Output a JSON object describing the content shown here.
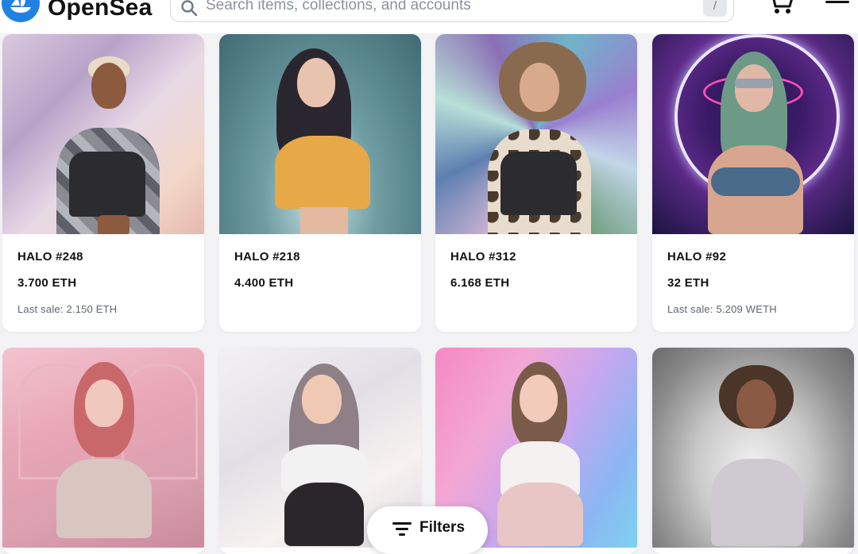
{
  "header": {
    "logo_text": "OpenSea",
    "search_placeholder": "Search items, collections, and accounts",
    "search_shortcut": "/"
  },
  "cards": [
    {
      "name": "HALO #248",
      "price": "3.700 ETH",
      "last_sale": "Last sale: 2.150 ETH"
    },
    {
      "name": "HALO #218",
      "price": "4.400 ETH",
      "last_sale": ""
    },
    {
      "name": "HALO #312",
      "price": "6.168 ETH",
      "last_sale": ""
    },
    {
      "name": "HALO #92",
      "price": "32 ETH",
      "last_sale": "Last sale: 5.209 WETH"
    }
  ],
  "filters_label": "Filters",
  "colors": {
    "accent": "#2081e2",
    "text": "#121212",
    "muted": "#5e6670",
    "background": "#f3f3f5"
  }
}
